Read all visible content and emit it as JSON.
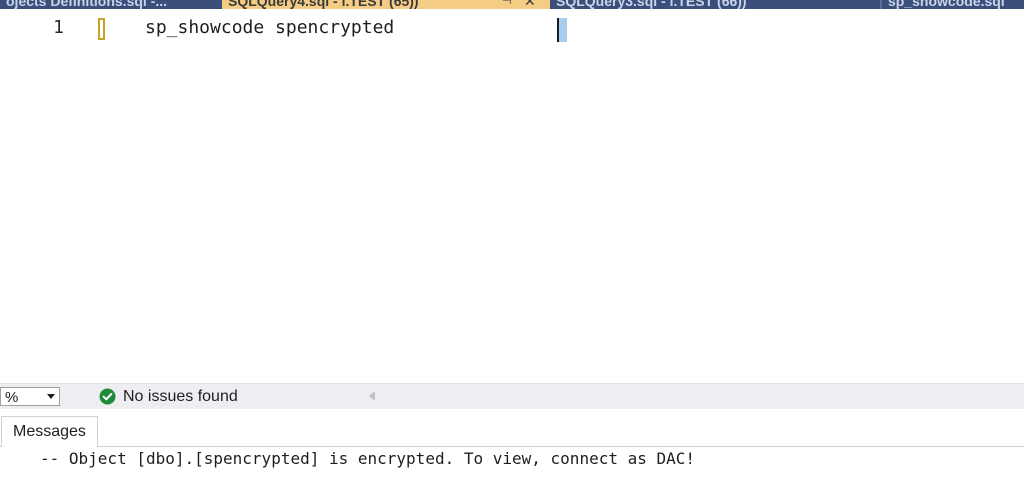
{
  "tabs": [
    {
      "label": "ojects Definitions.sql -..."
    },
    {
      "label": "SQLQuery4.sql - l.TEST (65))",
      "active": true
    },
    {
      "label": "SQLQuery3.sql - l.TEST (66))"
    },
    {
      "label": "sp_showcode.sql"
    }
  ],
  "editor": {
    "line_number": "1",
    "code": "sp_showcode spencrypted"
  },
  "status": {
    "zoom": "%",
    "issues": "No issues found"
  },
  "results": {
    "tab_label": "Messages",
    "message": "-- Object [dbo].[spencrypted] is encrypted. To view, connect as DAC!"
  },
  "colors": {
    "active_tab": "#f5cc84",
    "tab_strip": "#3a4f7a",
    "ok_green": "#1f8a3a"
  }
}
